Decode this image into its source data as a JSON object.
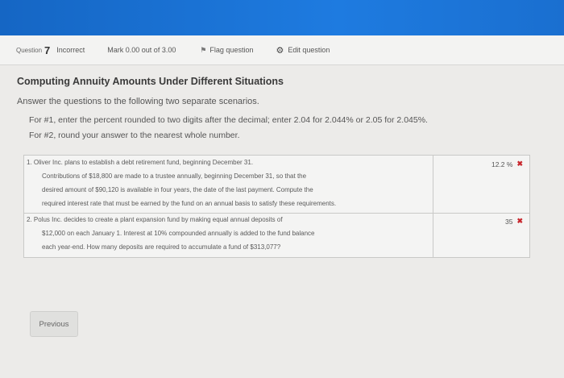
{
  "header": {
    "question_label": "Question",
    "question_number": "7",
    "status": "Incorrect",
    "mark": "Mark 0.00 out of 3.00",
    "flag_label": "Flag question",
    "edit_label": "Edit question",
    "accent_color": "#1a6fd0"
  },
  "content": {
    "title": "Computing Annuity Amounts Under Different Situations",
    "subtitle": "Answer the questions to the following two separate scenarios.",
    "instruction_1": "For #1, enter the percent rounded to two digits after the decimal; enter 2.04 for 2.044% or 2.05 for 2.045%.",
    "instruction_2": "For #2, round your answer to the nearest whole number."
  },
  "questions": [
    {
      "lines": [
        "1. Oliver Inc. plans to establish a debt retirement fund, beginning December 31.",
        "Contributions of $18,800 are made to a trustee annually, beginning December 31, so that the",
        "desired amount of $90,120 is available in four years, the date of the last payment. Compute the",
        "required interest rate that must be earned by the fund on an annual basis to satisfy these requirements."
      ],
      "answer": "12.2 %"
    },
    {
      "lines": [
        "2. Polus Inc. decides to create a plant expansion fund by making equal annual deposits of",
        "$12,000 on each January 1. Interest at 10% compounded annually is added to the fund balance",
        "each year-end. How many deposits are required to accumulate a fund of $313,077?"
      ],
      "answer": "35"
    }
  ],
  "footer": {
    "previous_label": "Previous"
  },
  "icons": {
    "flag": "flag-icon",
    "gear": "gear-icon",
    "incorrect": "x-icon"
  },
  "colors": {
    "incorrect_mark": "#c8272d"
  }
}
